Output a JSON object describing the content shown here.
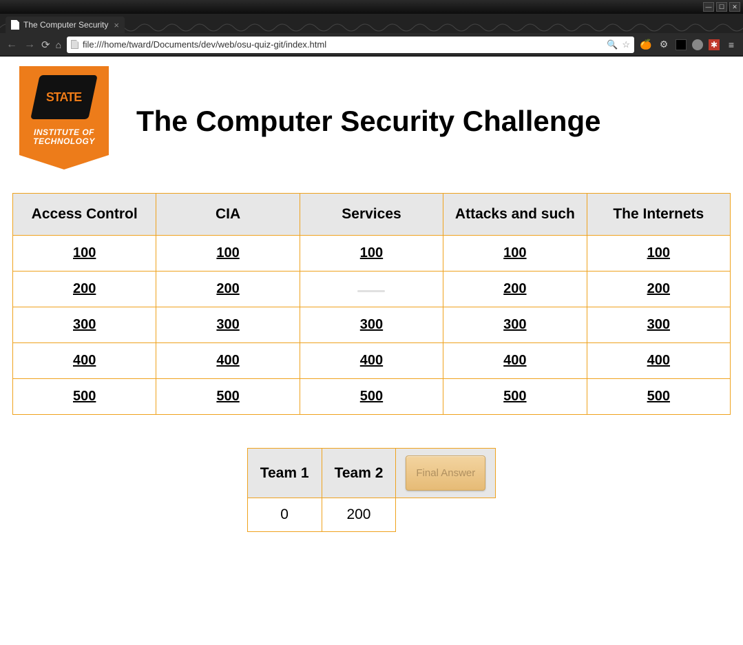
{
  "window": {
    "tab_title": "The Computer Security",
    "url": "file:///home/tward/Documents/dev/web/osu-quiz-git/index.html"
  },
  "logo": {
    "badge_text": "STATE",
    "subtitle_line1": "INSTITUTE OF",
    "subtitle_line2": "TECHNOLOGY"
  },
  "page": {
    "title": "The Computer Security Challenge"
  },
  "board": {
    "categories": [
      "Access Control",
      "CIA",
      "Services",
      "Attacks and such",
      "The Internets"
    ],
    "rows": [
      [
        {
          "value": "100",
          "used": false
        },
        {
          "value": "100",
          "used": false
        },
        {
          "value": "100",
          "used": false
        },
        {
          "value": "100",
          "used": false
        },
        {
          "value": "100",
          "used": false
        }
      ],
      [
        {
          "value": "200",
          "used": false
        },
        {
          "value": "200",
          "used": false
        },
        {
          "value": "",
          "used": true
        },
        {
          "value": "200",
          "used": false
        },
        {
          "value": "200",
          "used": false
        }
      ],
      [
        {
          "value": "300",
          "used": false
        },
        {
          "value": "300",
          "used": false
        },
        {
          "value": "300",
          "used": false
        },
        {
          "value": "300",
          "used": false
        },
        {
          "value": "300",
          "used": false
        }
      ],
      [
        {
          "value": "400",
          "used": false
        },
        {
          "value": "400",
          "used": false
        },
        {
          "value": "400",
          "used": false
        },
        {
          "value": "400",
          "used": false
        },
        {
          "value": "400",
          "used": false
        }
      ],
      [
        {
          "value": "500",
          "used": false
        },
        {
          "value": "500",
          "used": false
        },
        {
          "value": "500",
          "used": false
        },
        {
          "value": "500",
          "used": false
        },
        {
          "value": "500",
          "used": false
        }
      ]
    ]
  },
  "score": {
    "teams": [
      {
        "name": "Team 1",
        "score": "0"
      },
      {
        "name": "Team 2",
        "score": "200"
      }
    ],
    "final_button": "Final Answer"
  }
}
